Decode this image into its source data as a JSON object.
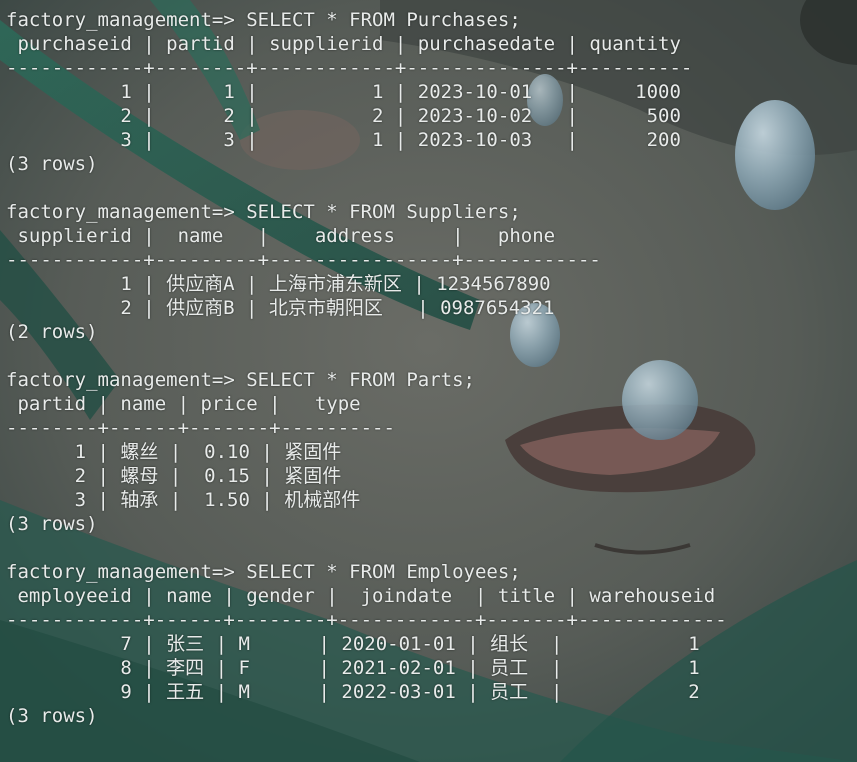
{
  "terminal": {
    "lines": [
      "factory_management=> SELECT * FROM Purchases;",
      " purchaseid | partid | supplierid | purchasedate | quantity",
      "------------+--------+------------+--------------+----------",
      "          1 |      1 |          1 | 2023-10-01   |     1000",
      "          2 |      2 |          2 | 2023-10-02   |      500",
      "          3 |      3 |          1 | 2023-10-03   |      200",
      "(3 rows)",
      "",
      "factory_management=> SELECT * FROM Suppliers;",
      " supplierid |  name   |    address     |   phone",
      "------------+---------+----------------+------------",
      "          1 | 供应商A | 上海市浦东新区 | 1234567890",
      "          2 | 供应商B | 北京市朝阳区   | 0987654321",
      "(2 rows)",
      "",
      "factory_management=> SELECT * FROM Parts;",
      " partid | name | price |   type",
      "--------+------+-------+----------",
      "      1 | 螺丝 |  0.10 | 紧固件",
      "      2 | 螺母 |  0.15 | 紧固件",
      "      3 | 轴承 |  1.50 | 机械部件",
      "(3 rows)",
      "",
      "factory_management=> SELECT * FROM Employees;",
      " employeeid | name | gender |  joindate  | title | warehouseid",
      "------------+------+--------+------------+-------+-------------",
      "          7 | 张三 | M      | 2020-01-01 | 组长  |           1",
      "          8 | 李四 | F      | 2021-02-01 | 员工  |           1",
      "          9 | 王五 | M      | 2022-03-01 | 员工  |           2",
      "(3 rows)"
    ]
  },
  "colors": {
    "text": "#e8ebea",
    "background": "#3f4a46",
    "hair": "#2f6b5c",
    "skin": "#5a5e58"
  }
}
